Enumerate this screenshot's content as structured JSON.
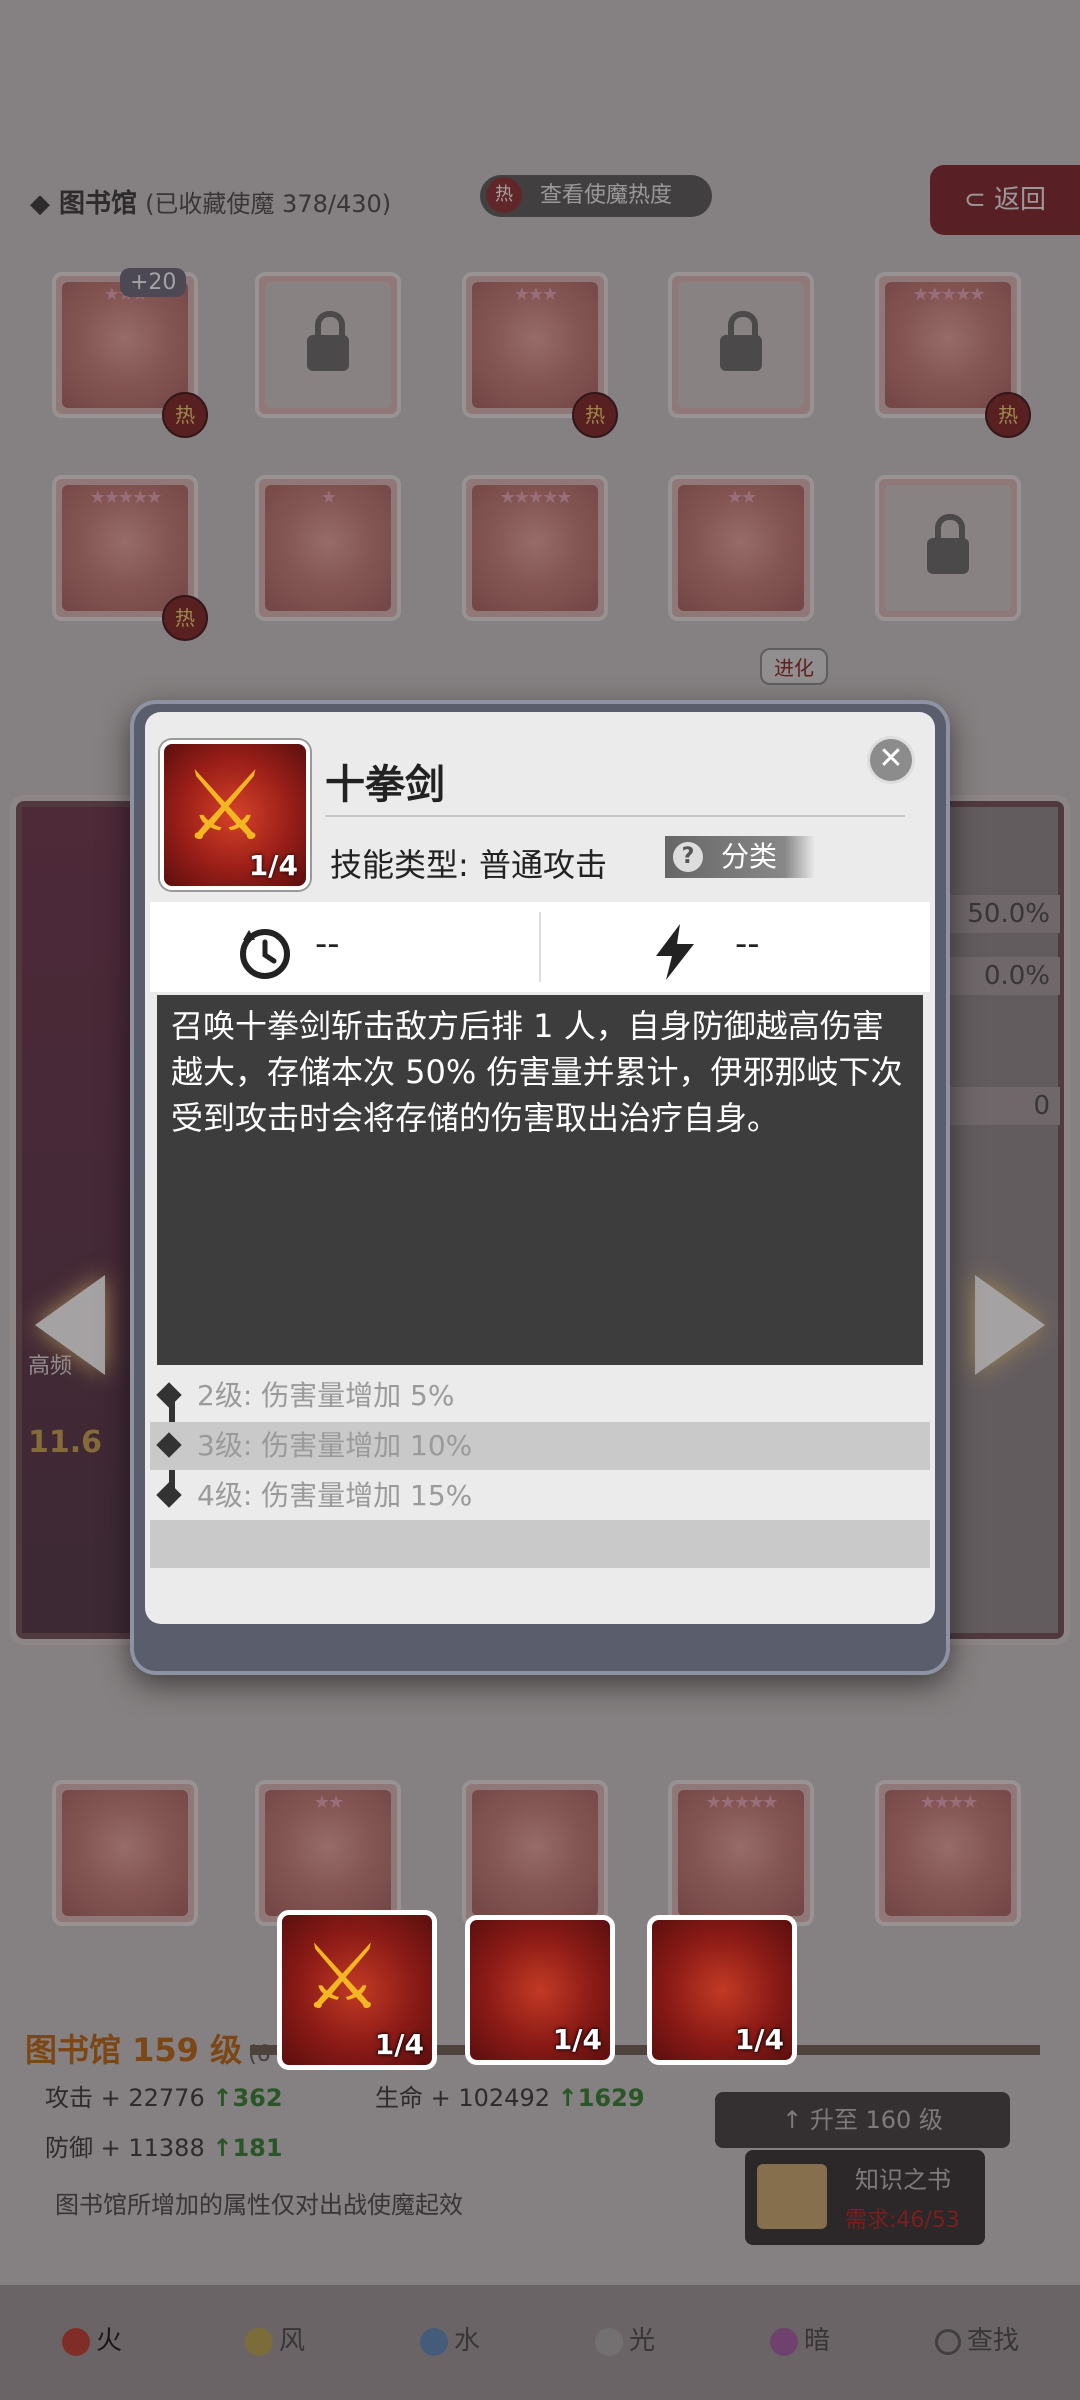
{
  "library": {
    "title": "图书馆",
    "collected": "(已收藏使魔 378/430)",
    "heat_button": "查看使魔热度",
    "heat_icon_text": "热",
    "back_label": "返回",
    "plus_badge": "+20",
    "evolve_badge": "进化"
  },
  "hero_panel": {
    "stats": [
      "50.0%",
      "0.0%",
      "0"
    ],
    "left_label": "高频",
    "left_value": "11.6"
  },
  "bottom": {
    "level": "图书馆 159 级",
    "level_sub": "(6",
    "attack": "攻击 + 22776",
    "attack_up": "↑362",
    "hp": "生命 + 102492",
    "hp_up": "↑1629",
    "defense": "防御 + 11388",
    "defense_up": "↑181",
    "note": "图书馆所增加的属性仅对出战使魔起效",
    "upgrade": "↑ 升至 160 级",
    "book_title": "知识之书",
    "book_req": "需求:46/53"
  },
  "tabs": [
    "火",
    "风",
    "水",
    "光",
    "暗",
    "查找"
  ],
  "skills": [
    {
      "level": "1/4"
    },
    {
      "level": "1/4"
    },
    {
      "level": "1/4"
    }
  ],
  "popup": {
    "name": "十拳剑",
    "level": "1/4",
    "type_label": "技能类型:",
    "type_value": "普通攻击",
    "category": "分类",
    "close": "✕",
    "cooldown": "--",
    "energy": "--",
    "description": "召唤十拳剑斩击敌方后排 1 人，自身防御越高伤害越大，存储本次 50% 伤害量并累计，伊邪那岐下次受到攻击时会将存储的伤害取出治疗自身。",
    "upgrades": [
      "2级: 伤害量增加 5%",
      "3级: 伤害量增加 10%",
      "4级: 伤害量增加 15%"
    ]
  }
}
